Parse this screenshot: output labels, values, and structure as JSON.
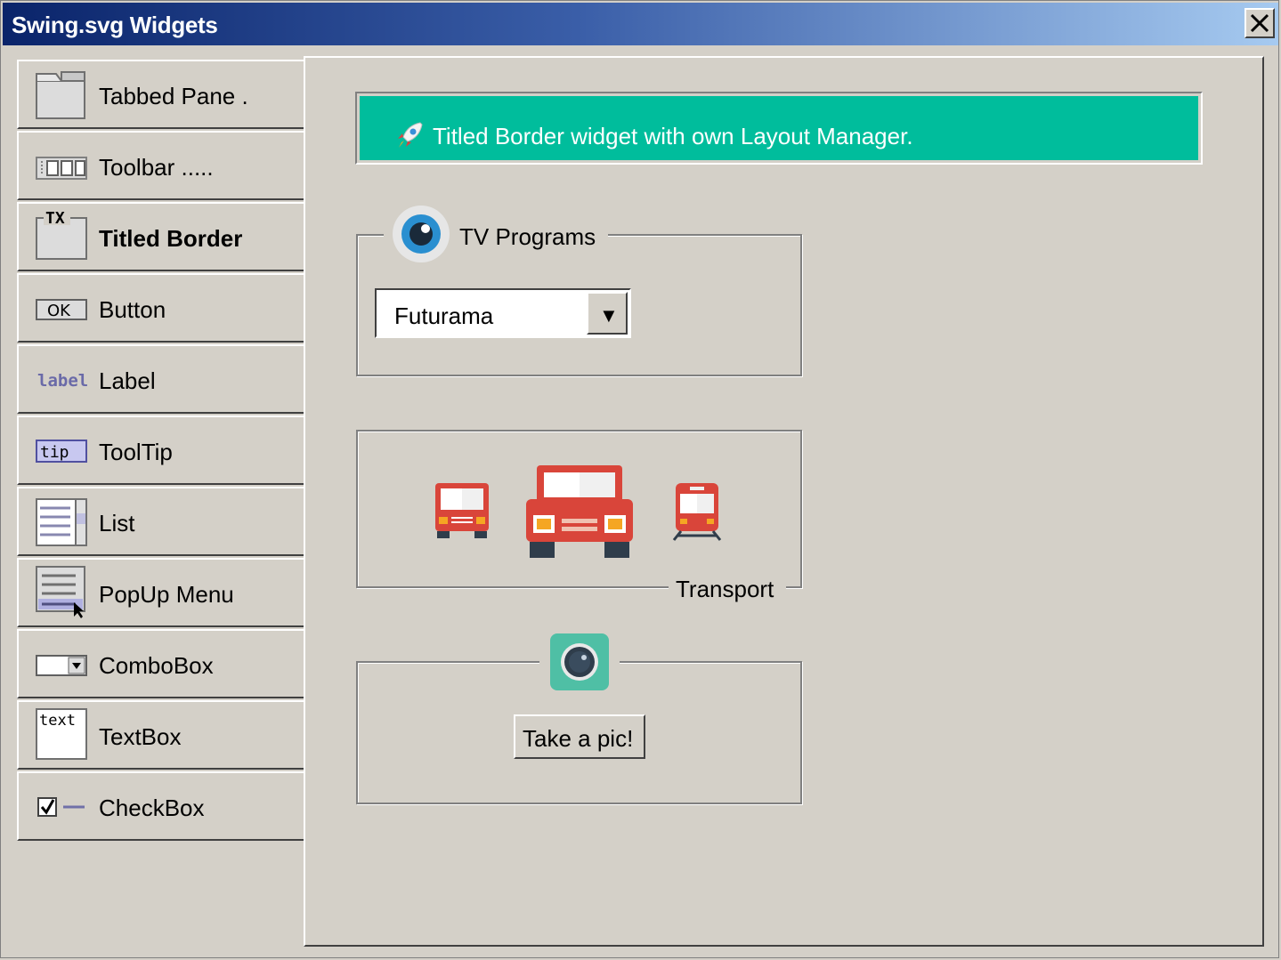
{
  "window": {
    "title": "Swing.svg Widgets",
    "close_icon": "close-icon"
  },
  "sidebar": {
    "items": [
      {
        "label": "Tabbed Pane .",
        "icon": "tabbed-pane-icon"
      },
      {
        "label": "Toolbar .....",
        "icon": "toolbar-icon"
      },
      {
        "label": "Titled Border",
        "icon": "titled-border-icon",
        "active": true
      },
      {
        "label": "Button",
        "icon": "button-icon",
        "icon_text": "OK"
      },
      {
        "label": "Label",
        "icon": "label-icon",
        "icon_text": "label"
      },
      {
        "label": "ToolTip",
        "icon": "tooltip-icon",
        "icon_text": "tip"
      },
      {
        "label": "List",
        "icon": "list-icon"
      },
      {
        "label": "PopUp Menu",
        "icon": "popup-menu-icon"
      },
      {
        "label": "ComboBox",
        "icon": "combobox-icon"
      },
      {
        "label": "TextBox",
        "icon": "textbox-icon",
        "icon_text": "text"
      },
      {
        "label": "CheckBox",
        "icon": "checkbox-icon"
      }
    ],
    "titled_border_icon_text": "TX"
  },
  "main": {
    "banner": {
      "text": "Titled Border widget with own Layout Manager.",
      "icon": "rocket-icon",
      "color": "#00bd9c"
    },
    "tv_group": {
      "title": "TV Programs",
      "icon": "eye-icon",
      "combo_value": "Futurama"
    },
    "transport_group": {
      "title": "Transport",
      "icons": [
        "bus-icon",
        "car-icon",
        "train-icon"
      ]
    },
    "camera_group": {
      "icon": "camera-icon",
      "button_label": "Take a pic!"
    }
  },
  "colors": {
    "title_gradient_start": "#0a246a",
    "title_gradient_end": "#a6caf0",
    "background": "#d4d0c8",
    "vehicle_red": "#d9453a",
    "camera_bg": "#4fbfa5"
  }
}
